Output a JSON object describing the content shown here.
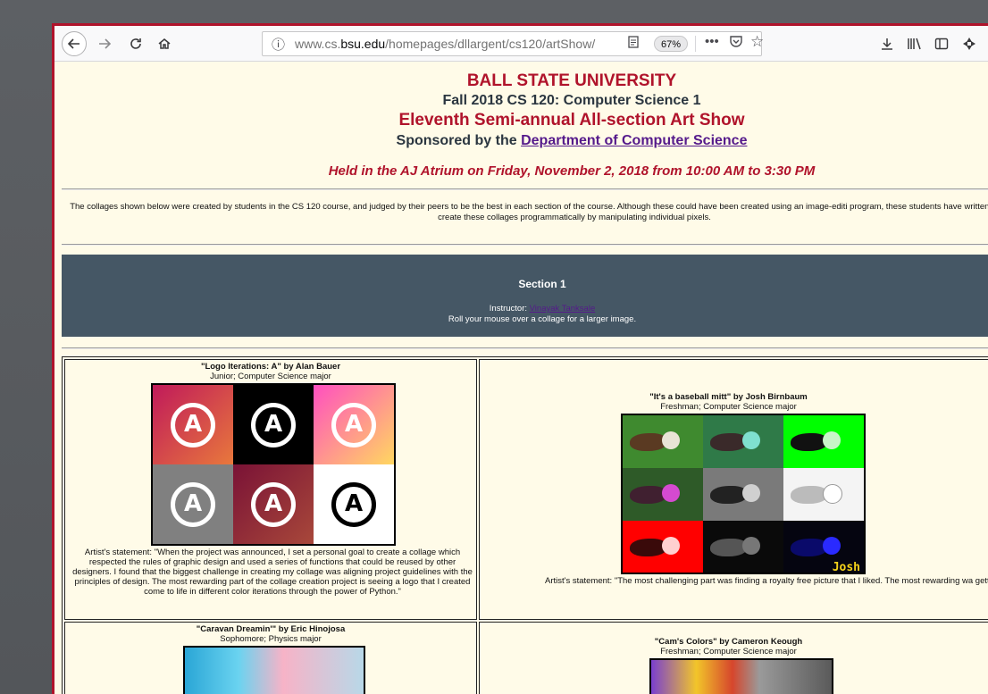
{
  "browser": {
    "url_prefix": "www.cs.",
    "url_domain": "bsu.edu",
    "url_path": "/homepages/dllargent/cs120/artShow/",
    "zoom": "67%",
    "icons": [
      "back-icon",
      "forward-icon",
      "reload-icon",
      "home-icon",
      "info-icon",
      "reader-icon",
      "page-actions-icon",
      "pocket-icon",
      "bookmark-star-icon",
      "download-icon",
      "library-icon",
      "sidebar-icon",
      "extension-icon"
    ]
  },
  "header": {
    "university": "BALL STATE UNIVERSITY",
    "course": "Fall 2018 CS 120: Computer Science 1",
    "show": "Eleventh Semi-annual All-section Art Show",
    "sponsor_prefix": "Sponsored by the ",
    "sponsor_link": "Department of Computer Science",
    "event": "Held in the AJ Atrium on Friday, November 2, 2018 from 10:00 AM to 3:30 PM"
  },
  "intro": "The collages shown below were created by students in the CS 120 course, and judged by their peers to be the best in each section of the course. Although these could have been created using an image-editi program, these students have written the code themselves to create these collages programmatically by manipulating individual pixels.",
  "section": {
    "title": "Section 1",
    "instructor_label": "Instructor: ",
    "instructor_name": "Vinayak Tanksale",
    "hint": "Roll your mouse over a collage for a larger image."
  },
  "entries": [
    {
      "title": "\"Logo Iterations: A\" by Alan Bauer",
      "subtitle": "Junior; Computer Science major",
      "statement": "Artist's statement: \"When the project was announced, I set a personal goal to create a collage which respected the rules of graphic design and used a series of functions that could be reused by other designers. I found that the biggest challenge in creating my collage was aligning project guidelines with the principles of design. The most rewarding part of the collage creation project is seeing a logo that I created come to life in different color iterations through the power of Python.\""
    },
    {
      "title": "\"It's a baseball mitt\" by Josh Birnbaum",
      "subtitle": "Freshman; Computer Science major",
      "signature": "Josh",
      "statement": "Artist's statement: \"The most challenging part was finding a royalty free picture that I liked. The most rewarding wa getting an A.\""
    },
    {
      "title": "\"Caravan Dreamin'\" by Eric Hinojosa",
      "subtitle": "Sophomore; Physics major"
    },
    {
      "title": "\"Cam's Colors\" by Cameron Keough",
      "subtitle": "Freshman; Computer Science major"
    }
  ]
}
